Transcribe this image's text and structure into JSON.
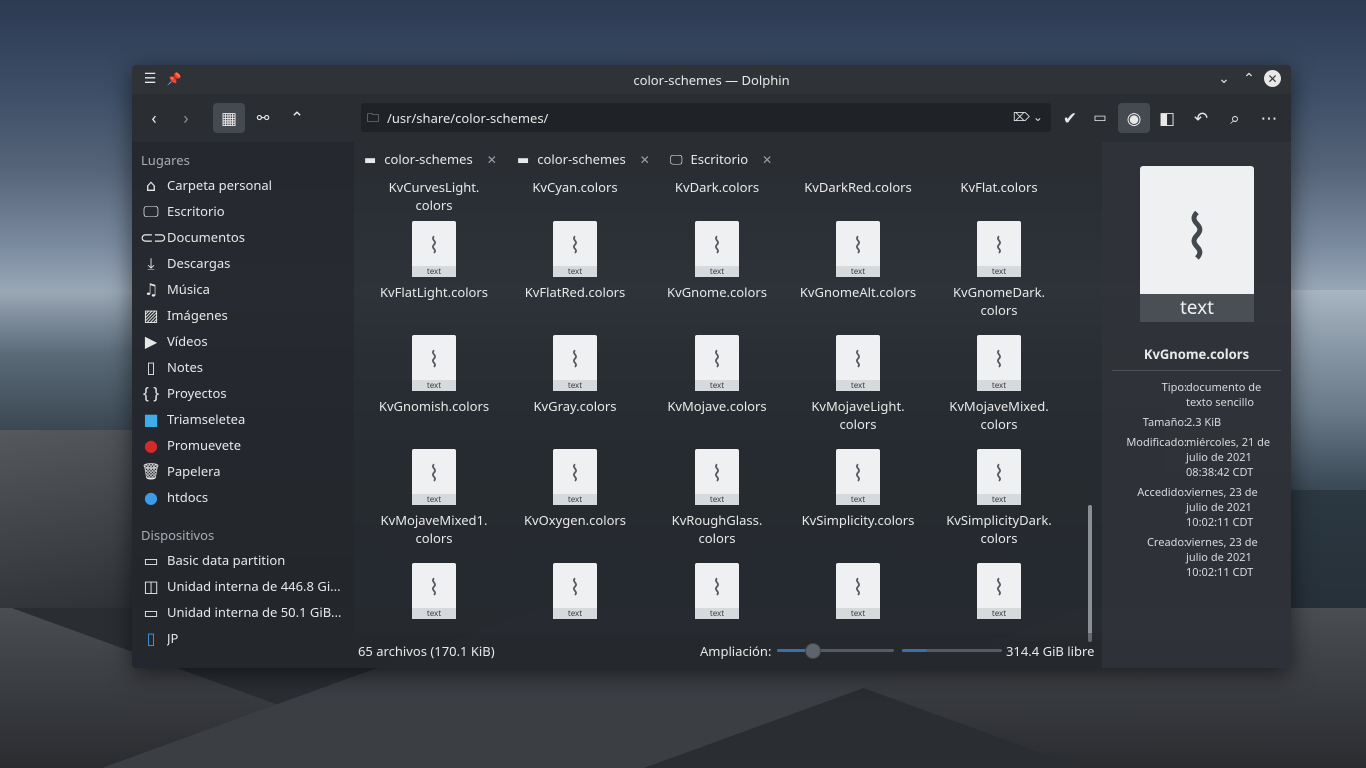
{
  "window": {
    "title": "color-schemes — Dolphin"
  },
  "toolbar": {
    "path": "/usr/share/color-schemes/"
  },
  "sidebar": {
    "places_title": "Lugares",
    "places": [
      {
        "label": "Carpeta personal",
        "icon": "home-icon"
      },
      {
        "label": "Escritorio",
        "icon": "desktop-icon"
      },
      {
        "label": "Documentos",
        "icon": "documents-icon"
      },
      {
        "label": "Descargas",
        "icon": "downloads-icon"
      },
      {
        "label": "Música",
        "icon": "music-icon"
      },
      {
        "label": "Imágenes",
        "icon": "pictures-icon"
      },
      {
        "label": "Vídeos",
        "icon": "videos-icon"
      },
      {
        "label": "Notes",
        "icon": "notes-icon"
      },
      {
        "label": "Proyectos",
        "icon": "braces-icon"
      },
      {
        "label": "Triamseletea",
        "icon": "folder-blue-icon"
      },
      {
        "label": "Promuevete",
        "icon": "red-circle-icon"
      },
      {
        "label": "Papelera",
        "icon": "trash-icon"
      },
      {
        "label": "htdocs",
        "icon": "globe-icon"
      }
    ],
    "devices_title": "Dispositivos",
    "devices": [
      {
        "label": "Basic data partition",
        "icon": "drive-icon"
      },
      {
        "label": "Unidad interna de 446.8 Gi...",
        "icon": "disk-icon"
      },
      {
        "label": "Unidad interna de 50.1 GiB...",
        "icon": "drive-icon"
      },
      {
        "label": "JP",
        "icon": "phone-icon"
      }
    ]
  },
  "tabs": [
    {
      "label": "color-schemes",
      "icon": "folder-icon"
    },
    {
      "label": "color-schemes",
      "icon": "folder-icon"
    },
    {
      "label": "Escritorio",
      "icon": "desktop-icon"
    }
  ],
  "files": {
    "type_label": "text",
    "row0": [
      "KvCurvesLight.\ncolors",
      "KvCyan.colors",
      "KvDark.colors",
      "KvDarkRed.colors",
      "KvFlat.colors"
    ],
    "row1": [
      "KvFlatLight.colors",
      "KvFlatRed.colors",
      "KvGnome.colors",
      "KvGnomeAlt.colors",
      "KvGnomeDark.\ncolors"
    ],
    "row2": [
      "KvGnomish.colors",
      "KvGray.colors",
      "KvMojave.colors",
      "KvMojaveLight.\ncolors",
      "KvMojaveMixed.\ncolors"
    ],
    "row3": [
      "KvMojaveMixed1.\ncolors",
      "KvOxygen.colors",
      "KvRoughGlass.\ncolors",
      "KvSimplicity.colors",
      "KvSimplicityDark.\ncolors"
    ]
  },
  "status": {
    "summary": "65 archivos (170.1 KiB)",
    "zoom_label": "Ampliación:",
    "zoom_level": 0.3,
    "free_fraction": 0.25,
    "free_text": "314.4 GiB libre"
  },
  "info": {
    "type_label": "text",
    "name": "KvGnome.colors",
    "rows": [
      {
        "key": "Tipo:",
        "value": "documento de texto sencillo"
      },
      {
        "key": "Tamaño:",
        "value": "2.3 KiB"
      },
      {
        "key": "Modificado:",
        "value": "miércoles, 21 de julio de 2021 08:38:42 CDT"
      },
      {
        "key": "Accedido:",
        "value": "viernes, 23 de julio de 2021 10:02:11 CDT"
      },
      {
        "key": "Creado:",
        "value": "viernes, 23 de julio de 2021 10:02:11 CDT"
      }
    ]
  }
}
